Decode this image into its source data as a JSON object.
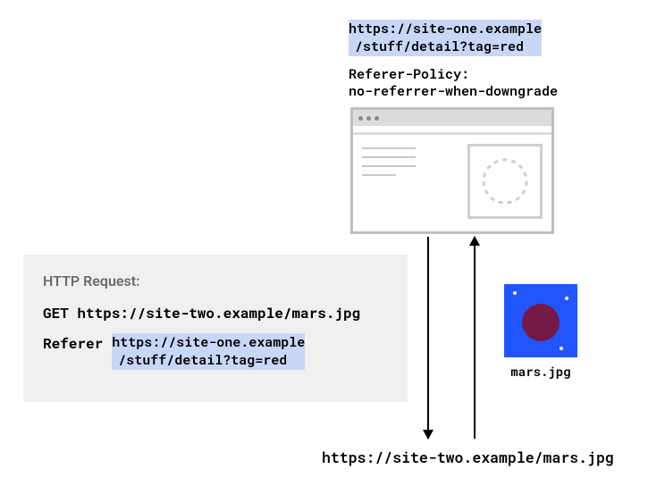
{
  "top_url": {
    "line1": "https://site-one.example",
    "line2": "/stuff/detail?tag=red"
  },
  "policy": {
    "line1": "Referer-Policy:",
    "line2": "no-referrer-when-downgrade"
  },
  "http": {
    "title": "HTTP Request:",
    "get_line": "GET https://site-two.example/mars.jpg",
    "referer_label": "Referer",
    "referer_url_line1": "https://site-one.example",
    "referer_url_line2": "/stuff/detail?tag=red"
  },
  "mars_caption": "mars.jpg",
  "bottom_url": "https://site-two.example/mars.jpg"
}
